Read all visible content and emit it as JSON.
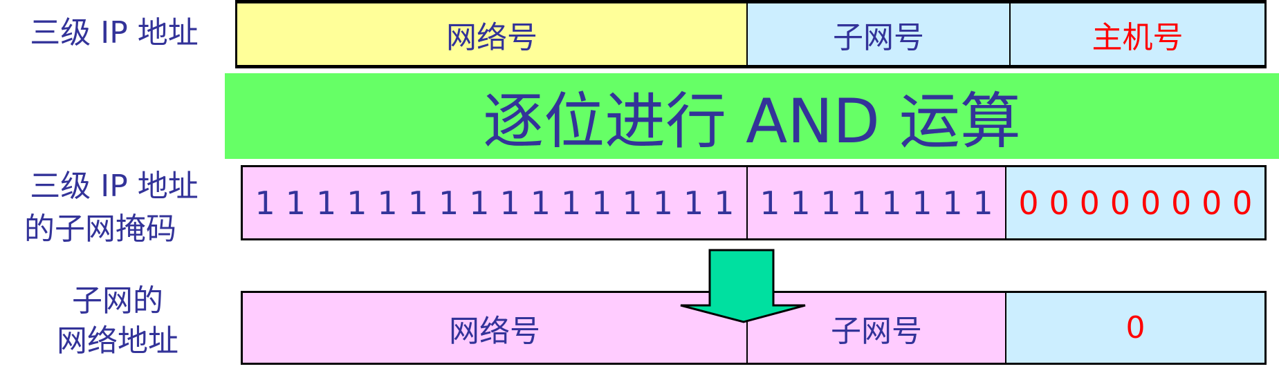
{
  "row1": {
    "label": "三级 IP 地址",
    "cells": [
      "网络号",
      "子网号",
      "主机号"
    ]
  },
  "operation": "逐位进行 AND 运算",
  "row2": {
    "label_line1": "三级 IP 地址",
    "label_line2": "的子网掩码",
    "network_bits": [
      "1",
      "1",
      "1",
      "1",
      "1",
      "1",
      "1",
      "1",
      "1",
      "1",
      "1",
      "1",
      "1",
      "1",
      "1",
      "1"
    ],
    "subnet_bits": [
      "1",
      "1",
      "1",
      "1",
      "1",
      "1",
      "1",
      "1"
    ],
    "host_bits": [
      "0",
      "0",
      "0",
      "0",
      "0",
      "0",
      "0",
      "0"
    ]
  },
  "row3": {
    "label_line1": "子网的",
    "label_line2": "网络地址",
    "cells": [
      "网络号",
      "子网号",
      "0"
    ]
  },
  "colors": {
    "text": "#333399",
    "highlight": "#ff0000",
    "network_bg": "#ffff99",
    "subnet_bg": "#cceeff",
    "mask_bg": "#ffccff",
    "operation_bg": "#66ff66",
    "arrow": "#00e0a0"
  }
}
